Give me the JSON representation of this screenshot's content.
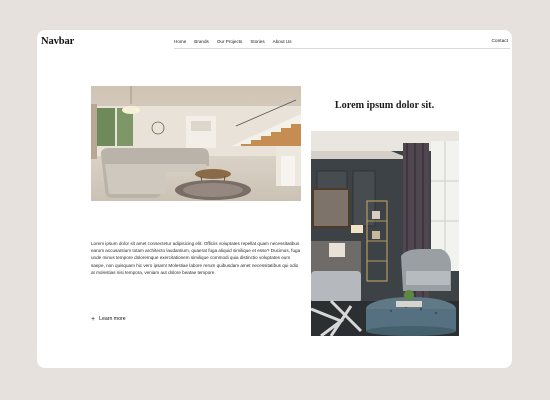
{
  "nav": {
    "logo": "Navbar",
    "links": [
      "Home",
      "Brands",
      "Our Projects",
      "Stories",
      "About Us"
    ],
    "contact": "Contact"
  },
  "hero": {
    "heading": "Lorem ipsum dolor sit.",
    "paragraph": "Lorem ipsum dolor sit amet consectetur adipisicing elit. Officiis voluptates repellat quam necessitatibus earum accusantium totam architecto laudantium, quaerat fuga aliquid similique et esse? Ducimus, fuga unde minus tempore doloremque exercitationem similique commodi quia distinctio voluptates eum saepe, non quisquam hic vero ipsam! Molestiae labore rerum quibusdam amet necessitatibus qui odio at molestias nisi tempora, veniam aut dolore beatae tempore.",
    "learn_more": "Learn more",
    "plus_icon": "plus-icon"
  }
}
